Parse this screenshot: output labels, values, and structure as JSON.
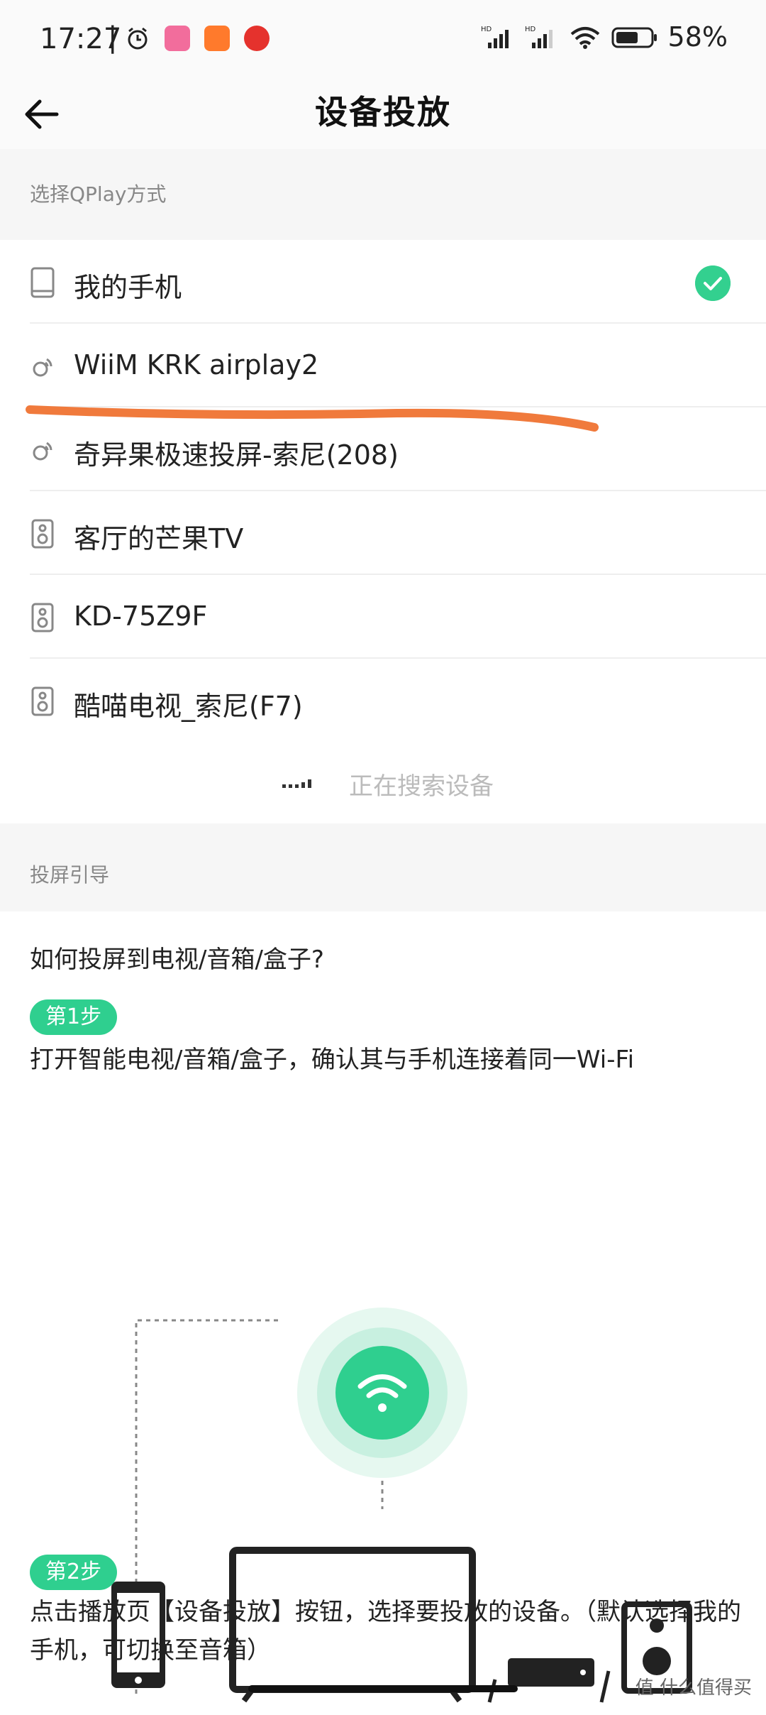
{
  "status_bar": {
    "time": "17:27",
    "separator": "|",
    "battery": "58%",
    "network_label_1": "HD",
    "network_label_2": "HD"
  },
  "header": {
    "title": "设备投放",
    "back_icon": "arrow-left-icon"
  },
  "section_qplay": {
    "label": "选择QPlay方式"
  },
  "devices": [
    {
      "label": "我的手机",
      "icon": "phone-icon",
      "selected": true
    },
    {
      "label": "WiiM KRK airplay2",
      "icon": "airplay-icon",
      "selected": false
    },
    {
      "label": "奇异果极速投屏-索尼(208)",
      "icon": "airplay-icon",
      "selected": false
    },
    {
      "label": "客厅的芒果TV",
      "icon": "speaker-icon",
      "selected": false
    },
    {
      "label": "KD-75Z9F",
      "icon": "speaker-icon",
      "selected": false
    },
    {
      "label": "酷喵电视_索尼(F7)",
      "icon": "speaker-icon",
      "selected": false
    }
  ],
  "searching": {
    "text": "正在搜索设备"
  },
  "section_guide": {
    "label": "投屏引导"
  },
  "guide": {
    "question": "如何投屏到电视/音箱/盒子?",
    "step1_badge": "第1步",
    "step1_text": "打开智能电视/音箱/盒子，确认其与手机连接着同一Wi-Fi",
    "step2_badge": "第2步",
    "step2_text": "点击播放页【设备投放】按钮，选择要投放的设备。（默认选择我的手机，可切换至音箱）"
  },
  "watermark": "值 什么值得买",
  "colors": {
    "accent": "#2fcf8f",
    "annotation": "#f07a3c"
  }
}
